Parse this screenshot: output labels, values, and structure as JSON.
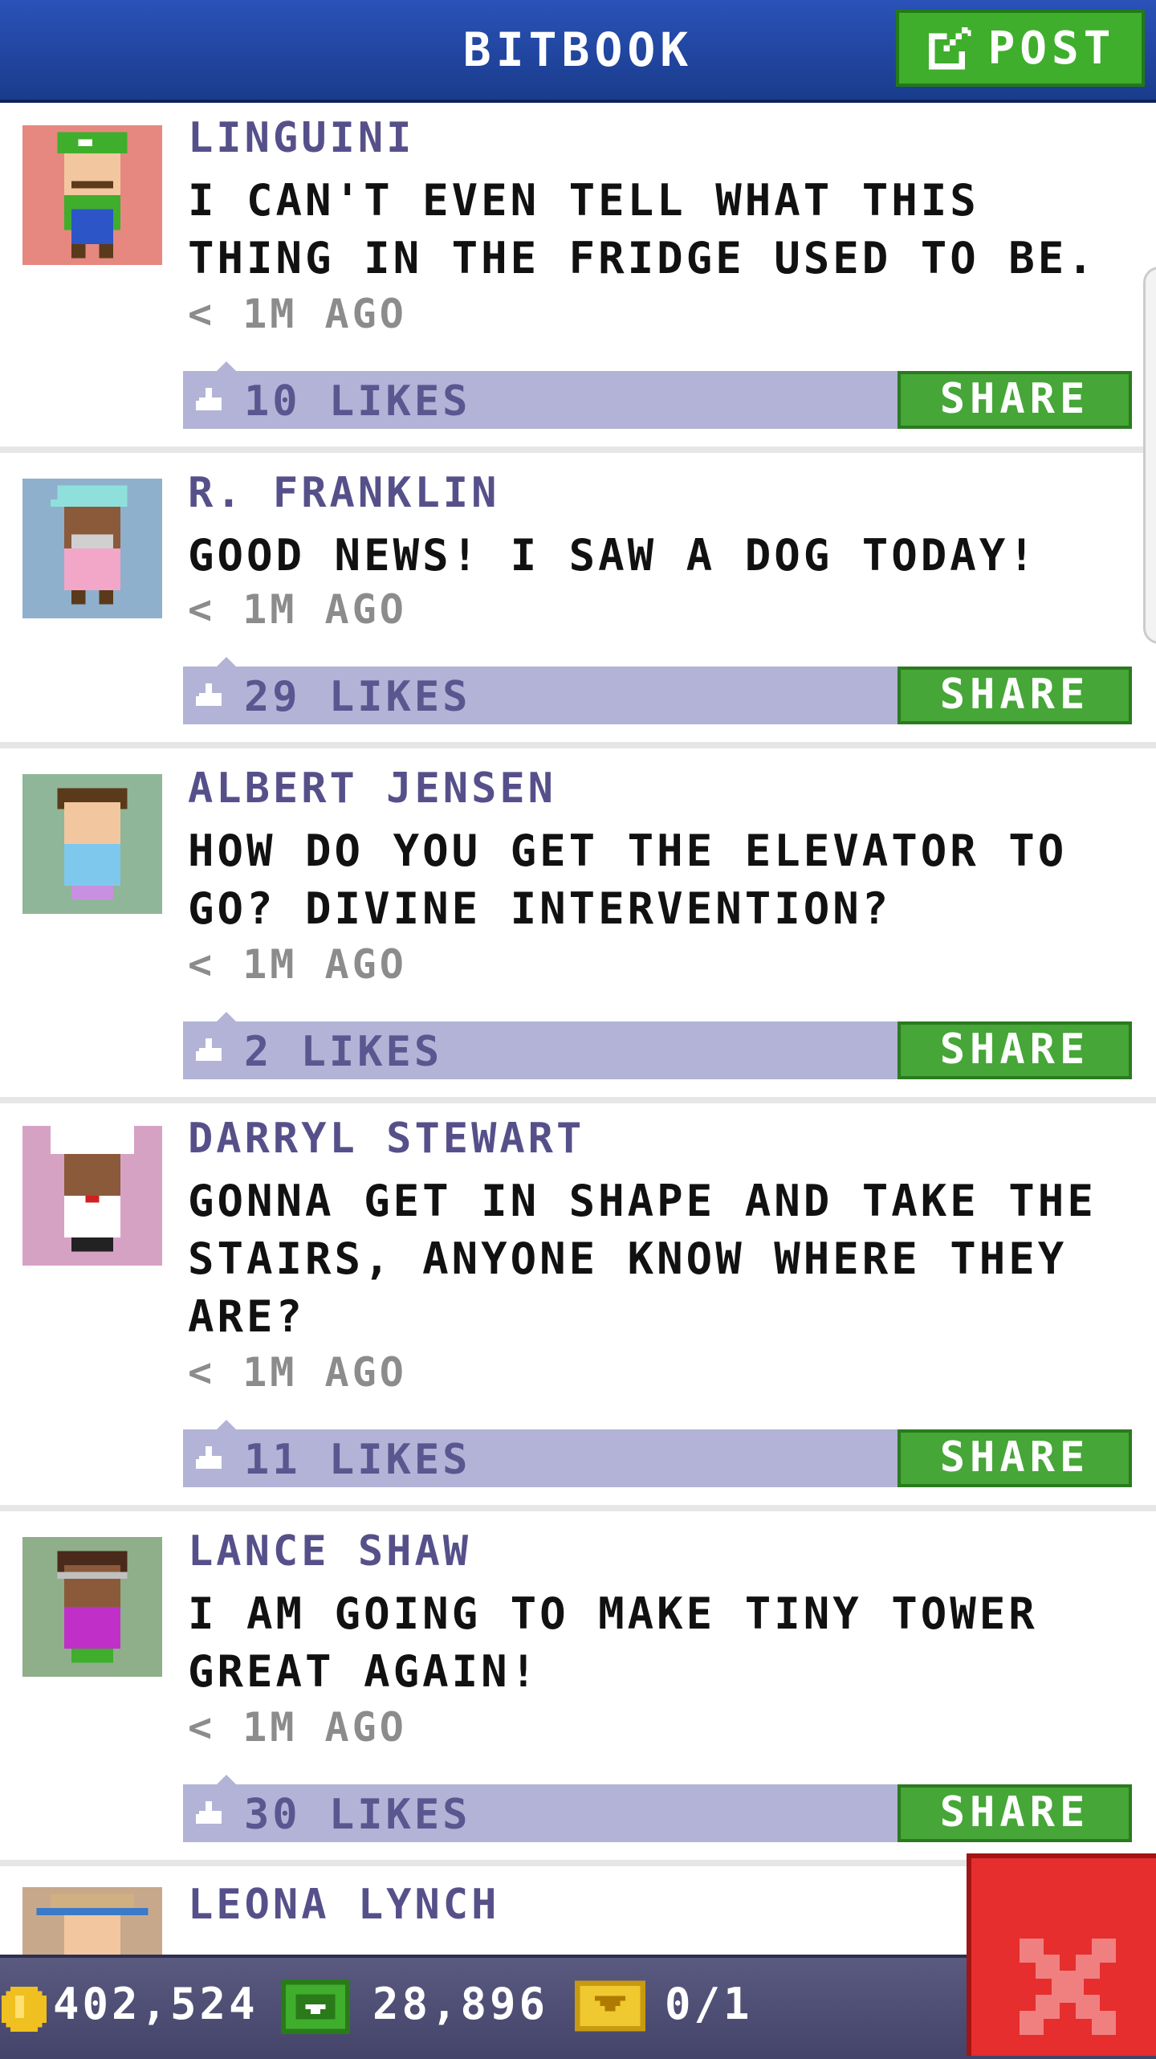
{
  "header": {
    "title": "BITBOOK",
    "post_label": "POST"
  },
  "posts": [
    {
      "author": "LINGUINI",
      "text": "I CAN'T EVEN TELL WHAT THIS THING IN THE FRIDGE USED TO BE.",
      "time": "< 1M AGO",
      "likes": "10 LIKES",
      "share": "SHARE",
      "avatar_bg": "#e6887f"
    },
    {
      "author": "R. FRANKLIN",
      "text": "GOOD NEWS! I SAW A DOG TODAY!",
      "time": "< 1M AGO",
      "likes": "29 LIKES",
      "share": "SHARE",
      "avatar_bg": "#8fb0cc"
    },
    {
      "author": "ALBERT JENSEN",
      "text": "HOW DO YOU GET THE ELEVATOR TO GO? DIVINE INTERVENTION?",
      "time": "< 1M AGO",
      "likes": "2 LIKES",
      "share": "SHARE",
      "avatar_bg": "#8fb698"
    },
    {
      "author": "DARRYL STEWART",
      "text": "GONNA GET IN SHAPE AND TAKE THE STAIRS, ANYONE KNOW WHERE THEY ARE?",
      "time": "< 1M AGO",
      "likes": "11 LIKES",
      "share": "SHARE",
      "avatar_bg": "#d6a2c4"
    },
    {
      "author": "LANCE SHAW",
      "text": "I AM GOING TO MAKE TINY TOWER GREAT AGAIN!",
      "time": "< 1M AGO",
      "likes": "30 LIKES",
      "share": "SHARE",
      "avatar_bg": "#8fae8a"
    },
    {
      "author": "LEONA LYNCH",
      "text": "",
      "time": "",
      "likes": "",
      "share": "",
      "avatar_bg": "#c8a88a"
    }
  ],
  "bottom_bar": {
    "coins": "402,524",
    "bux": "28,896",
    "tickets": "0/1"
  },
  "colors": {
    "header_blue": "#1f47a8",
    "post_green": "#3fae2c",
    "likes_bar": "#b2b3d6",
    "name_purple": "#56508a",
    "close_red": "#e62e2e"
  },
  "icons": [
    "edit-icon",
    "thumbs-up-icon",
    "coin-icon",
    "bux-icon",
    "ticket-icon",
    "close-icon"
  ]
}
